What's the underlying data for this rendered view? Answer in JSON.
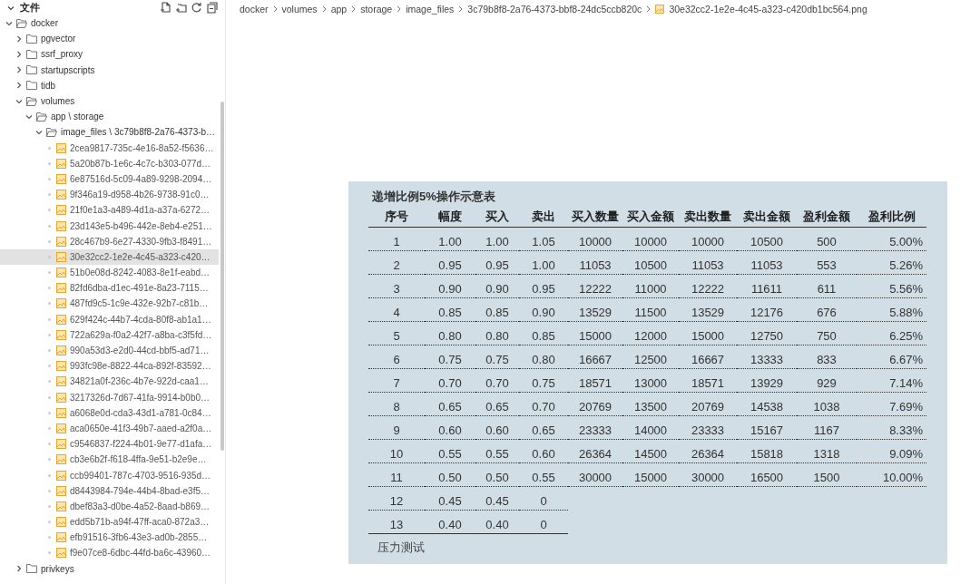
{
  "sidebar": {
    "title": "文件",
    "tree": [
      {
        "label": "docker",
        "kind": "folder",
        "expanded": true,
        "children": [
          {
            "label": "pgvector",
            "kind": "folder",
            "expanded": false
          },
          {
            "label": "ssrf_proxy",
            "kind": "folder",
            "expanded": false
          },
          {
            "label": "startupscripts",
            "kind": "folder",
            "expanded": false
          },
          {
            "label": "tidb",
            "kind": "folder",
            "expanded": false
          },
          {
            "label": "volumes",
            "kind": "folder",
            "expanded": true,
            "children": [
              {
                "label": "app \\ storage",
                "kind": "folder",
                "expanded": true,
                "children": [
                  {
                    "label": "image_files \\ 3c79b8f8-2a76-4373-b…",
                    "kind": "folder",
                    "expanded": true,
                    "children": [
                      {
                        "label": "2cea9817-735c-4e16-8a52-f5636…",
                        "kind": "file",
                        "selected": false
                      },
                      {
                        "label": "5a20b87b-1e6c-4c7c-b303-077d…",
                        "kind": "file",
                        "selected": false
                      },
                      {
                        "label": "6e87516d-5c09-4a89-9298-2094…",
                        "kind": "file",
                        "selected": false
                      },
                      {
                        "label": "9f346a19-d958-4b26-9738-91c0…",
                        "kind": "file",
                        "selected": false
                      },
                      {
                        "label": "21f0e1a3-a489-4d1a-a37a-6272…",
                        "kind": "file",
                        "selected": false
                      },
                      {
                        "label": "23d143e5-b496-442e-8eb4-e251…",
                        "kind": "file",
                        "selected": false
                      },
                      {
                        "label": "28c467b9-6e27-4330-9fb3-f8491…",
                        "kind": "file",
                        "selected": false
                      },
                      {
                        "label": "30e32cc2-1e2e-4c45-a323-c420…",
                        "kind": "file",
                        "selected": true
                      },
                      {
                        "label": "51b0e08d-8242-4083-8e1f-eabd…",
                        "kind": "file",
                        "selected": false
                      },
                      {
                        "label": "82fd6dba-d1ec-491e-8a23-7115…",
                        "kind": "file",
                        "selected": false
                      },
                      {
                        "label": "487fd9c5-1c9e-432e-92b7-c81b…",
                        "kind": "file",
                        "selected": false
                      },
                      {
                        "label": "629f424c-44b7-4cda-80f8-ab1a1…",
                        "kind": "file",
                        "selected": false
                      },
                      {
                        "label": "722a629a-f0a2-42f7-a8ba-c3f5fd…",
                        "kind": "file",
                        "selected": false
                      },
                      {
                        "label": "990a53d3-e2d0-44cd-bbf5-ad71…",
                        "kind": "file",
                        "selected": false
                      },
                      {
                        "label": "993fc98e-8822-44ca-892f-83592…",
                        "kind": "file",
                        "selected": false
                      },
                      {
                        "label": "34821a0f-236c-4b7e-922d-caa1…",
                        "kind": "file",
                        "selected": false
                      },
                      {
                        "label": "3217326d-7d67-41fa-9914-b0b0…",
                        "kind": "file",
                        "selected": false
                      },
                      {
                        "label": "a6068e0d-cda3-43d1-a781-0c84…",
                        "kind": "file",
                        "selected": false
                      },
                      {
                        "label": "aca0650e-41f3-49b7-aaed-a2f0a…",
                        "kind": "file",
                        "selected": false
                      },
                      {
                        "label": "c9546837-f224-4b01-9e77-d1afa…",
                        "kind": "file",
                        "selected": false
                      },
                      {
                        "label": "cb3e6b2f-f618-4ffa-9e51-b2e9e…",
                        "kind": "file",
                        "selected": false
                      },
                      {
                        "label": "ccb99401-787c-4703-9516-935d…",
                        "kind": "file",
                        "selected": false
                      },
                      {
                        "label": "d8443984-794e-44b4-8bad-e3f5…",
                        "kind": "file",
                        "selected": false
                      },
                      {
                        "label": "dbef83a3-d0be-4a52-8aad-b869…",
                        "kind": "file",
                        "selected": false
                      },
                      {
                        "label": "edd5b71b-a94f-47ff-aca0-872a3…",
                        "kind": "file",
                        "selected": false
                      },
                      {
                        "label": "efb91516-3fb6-43e3-ad0b-2855…",
                        "kind": "file",
                        "selected": false
                      },
                      {
                        "label": "f9e07ce8-6dbc-44fd-ba6c-43960…",
                        "kind": "file",
                        "selected": false
                      }
                    ]
                  }
                ]
              }
            ]
          },
          {
            "label": "privkeys",
            "kind": "folder",
            "expanded": false
          }
        ]
      }
    ]
  },
  "breadcrumb": [
    "docker",
    "volumes",
    "app",
    "storage",
    "image_files",
    "3c79b8f8-2a76-4373-bbf8-24dc5ccb820c",
    "30e32cc2-1e2e-4c45-a323-c420db1bc564.png"
  ],
  "document": {
    "title": "递增比例5%操作示意表",
    "columns": [
      "序号",
      "幅度",
      "买入",
      "卖出",
      "买入数量",
      "买入金额",
      "卖出数量",
      "卖出金额",
      "盈利金额",
      "盈利比例"
    ],
    "rows": [
      [
        "1",
        "1.00",
        "1.00",
        "1.05",
        "10000",
        "10000",
        "10000",
        "10500",
        "500",
        "5.00%"
      ],
      [
        "2",
        "0.95",
        "0.95",
        "1.00",
        "11053",
        "10500",
        "11053",
        "11053",
        "553",
        "5.26%"
      ],
      [
        "3",
        "0.90",
        "0.90",
        "0.95",
        "12222",
        "11000",
        "12222",
        "11611",
        "611",
        "5.56%"
      ],
      [
        "4",
        "0.85",
        "0.85",
        "0.90",
        "13529",
        "11500",
        "13529",
        "12176",
        "676",
        "5.88%"
      ],
      [
        "5",
        "0.80",
        "0.80",
        "0.85",
        "15000",
        "12000",
        "15000",
        "12750",
        "750",
        "6.25%"
      ],
      [
        "6",
        "0.75",
        "0.75",
        "0.80",
        "16667",
        "12500",
        "16667",
        "13333",
        "833",
        "6.67%"
      ],
      [
        "7",
        "0.70",
        "0.70",
        "0.75",
        "18571",
        "13000",
        "18571",
        "13929",
        "929",
        "7.14%"
      ],
      [
        "8",
        "0.65",
        "0.65",
        "0.70",
        "20769",
        "13500",
        "20769",
        "14538",
        "1038",
        "7.69%"
      ],
      [
        "9",
        "0.60",
        "0.60",
        "0.65",
        "23333",
        "14000",
        "23333",
        "15167",
        "1167",
        "8.33%"
      ],
      [
        "10",
        "0.55",
        "0.55",
        "0.60",
        "26364",
        "14500",
        "26364",
        "15818",
        "1318",
        "9.09%"
      ],
      [
        "11",
        "0.50",
        "0.50",
        "0.55",
        "30000",
        "15000",
        "30000",
        "16500",
        "1500",
        "10.00%"
      ],
      [
        "12",
        "0.45",
        "0.45",
        "0"
      ],
      [
        "13",
        "0.40",
        "0.40",
        "0"
      ]
    ],
    "footer": "压力测试"
  }
}
